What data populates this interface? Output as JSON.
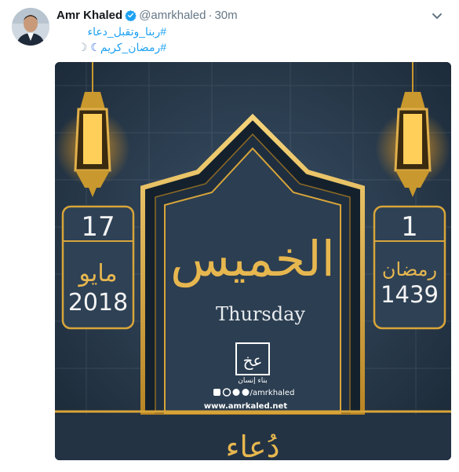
{
  "tweet": {
    "author_name": "Amr Khaled",
    "handle": "@amrkhaled",
    "separator": "·",
    "time": "30m",
    "hashtag_lines": [
      "#ربنا_وتقبل_دعاء",
      "#رمضان_كريم"
    ],
    "moon_icons": [
      "crescent-moon-icon",
      "crescent-moon-blue-icon"
    ],
    "colors": {
      "link": "#1da1f2",
      "name": "#14171a",
      "meta": "#657786",
      "verified": "#1da1f2"
    }
  },
  "card": {
    "day_arabic": "الخميس",
    "day_english": "Thursday",
    "gregorian": {
      "day": "17",
      "month": "مايو",
      "year": "2018"
    },
    "hijri": {
      "day": "1",
      "month": "رمضان",
      "year": "1439"
    },
    "logo_glyph": "عخ",
    "logo_caption": "بناء إنسان",
    "social_handle": "/amrkhaled",
    "website": "www.amrkaled.net",
    "footer_word": "دُعاء",
    "social_icons": [
      "youtube-icon",
      "instagram-icon",
      "twitter-icon",
      "facebook-icon"
    ],
    "colors": {
      "background": "#243445",
      "gold": "#d8a53a",
      "panel": "#2e4155"
    }
  }
}
